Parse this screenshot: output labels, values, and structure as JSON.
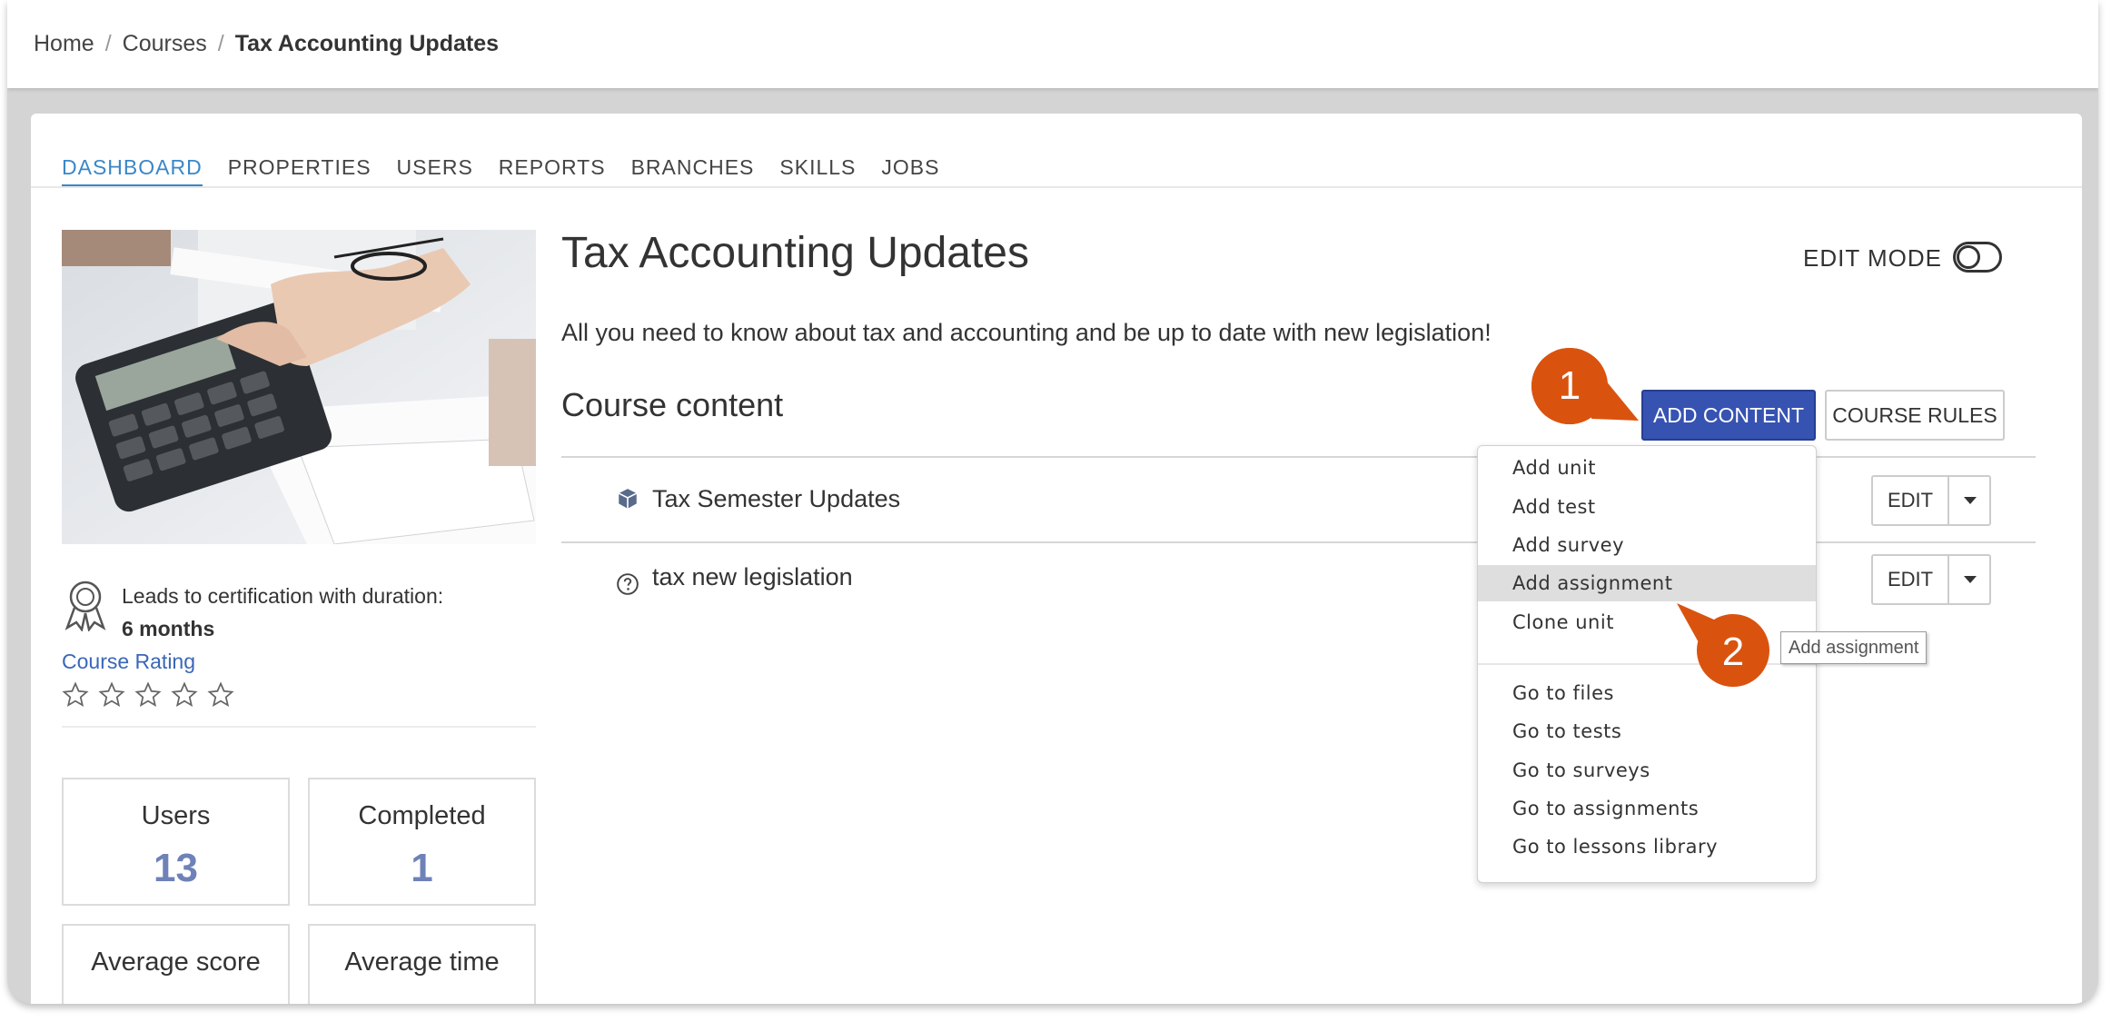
{
  "breadcrumb": {
    "home": "Home",
    "courses": "Courses",
    "current": "Tax Accounting Updates",
    "separator": "/"
  },
  "tabs": [
    {
      "label": "DASHBOARD",
      "active": true
    },
    {
      "label": "PROPERTIES"
    },
    {
      "label": "USERS"
    },
    {
      "label": "REPORTS"
    },
    {
      "label": "BRANCHES"
    },
    {
      "label": "SKILLS"
    },
    {
      "label": "JOBS"
    }
  ],
  "course": {
    "title": "Tax Accounting Updates",
    "description": "All you need to know about tax and accounting and be up to date with new legislation!",
    "edit_mode_label": "EDIT MODE"
  },
  "certification": {
    "line1": "Leads to certification with duration:",
    "duration": "6 months",
    "icon": "certificate-ribbon-icon"
  },
  "rating": {
    "label": "Course Rating",
    "stars_filled": 0,
    "stars_total": 5
  },
  "stats": {
    "users": {
      "label": "Users",
      "value": "13"
    },
    "completed": {
      "label": "Completed",
      "value": "1"
    },
    "average_score": {
      "label": "Average score"
    },
    "average_time": {
      "label": "Average time"
    }
  },
  "content": {
    "heading": "Course content",
    "add_content_label": "ADD CONTENT",
    "course_rules_label": "COURSE RULES",
    "units": [
      {
        "label": "Tax Semester Updates",
        "icon": "cube-icon",
        "edit_label": "EDIT"
      },
      {
        "label": "tax new legislation",
        "icon": "question-circle-icon",
        "edit_label": "EDIT"
      }
    ]
  },
  "menu": {
    "add_items": [
      "Add unit",
      "Add test",
      "Add survey",
      "Add assignment",
      "Clone unit"
    ],
    "goto_items": [
      "Go to files",
      "Go to tests",
      "Go to surveys",
      "Go to assignments",
      "Go to lessons library"
    ],
    "highlighted": "Add assignment"
  },
  "tooltip": "Add assignment",
  "callouts": [
    {
      "number": "1",
      "color": "#d9530f"
    },
    {
      "number": "2",
      "color": "#d9530f"
    }
  ],
  "colors": {
    "accent_tab": "#3a87c8",
    "primary_button": "#3653b2",
    "stat_number": "#6e82b8",
    "link": "#3a67b8"
  }
}
